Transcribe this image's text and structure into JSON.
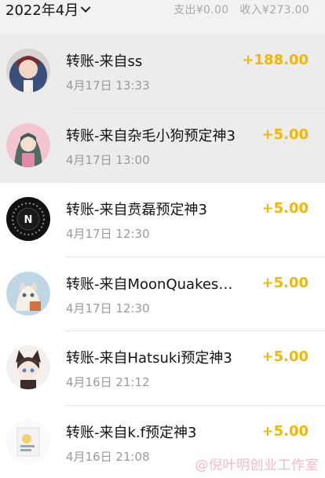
{
  "header": {
    "month": "2022年4月",
    "expense": "支出¥0.00",
    "income": "收入¥273.00"
  },
  "transactions": [
    {
      "title": "转账-来自ss",
      "time": "4月17日 13:33",
      "amount": "+188.00",
      "avatar": "portrait-avatar"
    },
    {
      "title": "转账-来自杂毛小狗预定神3",
      "time": "4月17日 13:00",
      "amount": "+5.00",
      "avatar": "anime-girl-avatar"
    },
    {
      "title": "转账-来自贲磊预定神3",
      "time": "4月17日 12:30",
      "amount": "+5.00",
      "avatar": "speedometer-avatar"
    },
    {
      "title": "转账-来自MoonQuakes预定神3",
      "time": "4月17日 12:30",
      "amount": "+5.00",
      "avatar": "cat-avatar"
    },
    {
      "title": "转账-来自Hatsuki预定神3",
      "time": "4月16日 21:12",
      "amount": "+5.00",
      "avatar": "fox-girl-avatar"
    },
    {
      "title": "转账-来自k.f预定神3",
      "time": "4月16日 21:08",
      "amount": "+5.00",
      "avatar": "sticker-avatar"
    }
  ],
  "watermark": "@倪叶明创业工作室",
  "colors": {
    "amount": "#f2b705",
    "header_bg": "#f2f2f2",
    "selected_row_bg": "#ececec",
    "watermark": "#f6b9c8"
  }
}
